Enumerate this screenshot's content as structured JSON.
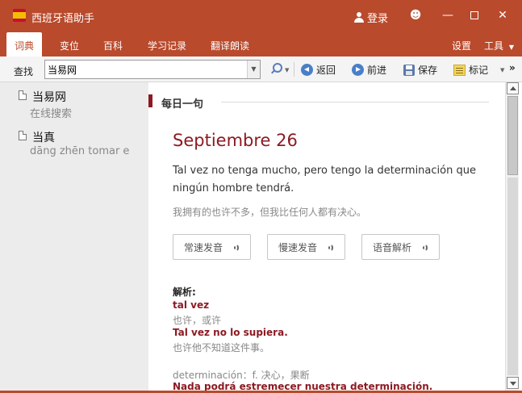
{
  "window": {
    "title": "西班牙语助手",
    "login_label": "登录",
    "controls": [
      "smiley-icon",
      "minimize-icon",
      "maximize-icon",
      "close-icon"
    ]
  },
  "menu": {
    "tabs": [
      {
        "label": "词典",
        "active": true
      },
      {
        "label": "变位",
        "active": false
      },
      {
        "label": "百科",
        "active": false
      },
      {
        "label": "学习记录",
        "active": false
      },
      {
        "label": "翻译朗读",
        "active": false
      }
    ],
    "settings_label": "设置",
    "tools_label": "工具"
  },
  "toolbar": {
    "search_label": "查找",
    "search_value": "当易网",
    "back_label": "返回",
    "forward_label": "前进",
    "save_label": "保存",
    "mark_label": "标记",
    "more_label": "»"
  },
  "sidebar": {
    "items": [
      {
        "word": "当易网",
        "sub": "在线搜索"
      },
      {
        "word": "当真",
        "sub": "dāng zhēn    tomar e"
      }
    ]
  },
  "main": {
    "section_title": "每日一句",
    "date": "Septiembre 26",
    "quote_es": "Tal vez no tenga mucho, pero tengo la determinación que ningún hombre tendrá.",
    "quote_zh": "我拥有的也许不多，但我比任何人都有决心。",
    "buttons": {
      "normal_speed": "常速发音",
      "slow_speed": "慢速发音",
      "analysis": "语音解析"
    },
    "analysis_title": "解析:",
    "terms": [
      {
        "term": "tal vez",
        "gloss": "也许，或许"
      },
      {
        "term": "Tal vez no lo supiera.",
        "gloss": "也许他不知道这件事。"
      }
    ],
    "word_def": "determinación：f. 决心，果断",
    "example": "Nada podrá estremecer nuestra determinación."
  },
  "colors": {
    "brand": "#b94a2c",
    "accent_dark_red": "#8c1a22"
  }
}
